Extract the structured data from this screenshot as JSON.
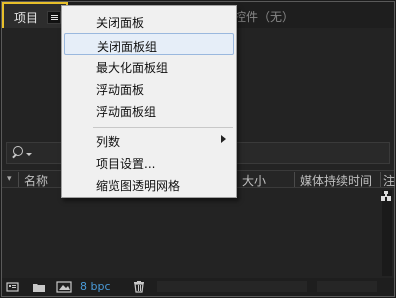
{
  "tabs": {
    "project_label": "项目",
    "effects_label": "控件（无）"
  },
  "columns": [
    "名称",
    "大小",
    "媒体持续时间",
    "注"
  ],
  "footer": {
    "bit_depth": "8 bpc"
  },
  "context_menu": {
    "items": [
      {
        "label": "关闭面板",
        "highlighted": false
      },
      {
        "label": "关闭面板组",
        "highlighted": true
      },
      {
        "label": "最大化面板组",
        "highlighted": false
      },
      {
        "label": "浮动面板",
        "highlighted": false
      },
      {
        "label": "浮动面板组",
        "highlighted": false
      },
      {
        "label": "列数",
        "highlighted": false,
        "submenu": true
      },
      {
        "label": "项目设置...",
        "highlighted": false
      },
      {
        "label": "缩览图透明网格",
        "highlighted": false
      }
    ]
  },
  "colors": {
    "active_tab_border": "#e8c02a",
    "bpc_text": "#4a9bd9",
    "menu_bg": "#f0f0f0",
    "panel_bg": "#232323"
  },
  "icons": [
    "panel-menu-icon",
    "search-icon",
    "sort-icon",
    "flowchart-icon",
    "interpret-footage-icon",
    "new-folder-icon",
    "new-composition-icon",
    "trash-icon",
    "submenu-arrow-icon"
  ]
}
